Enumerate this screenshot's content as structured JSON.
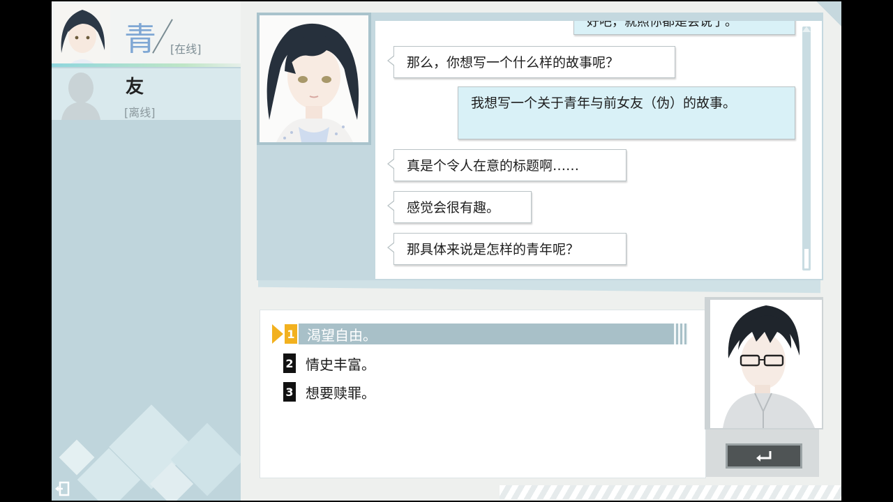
{
  "contacts": {
    "active": {
      "name": "青",
      "status": "[在线]"
    },
    "offline": {
      "name": "友",
      "status": "[离线]"
    }
  },
  "chat": {
    "messages": [
      {
        "side": "right",
        "text": "好吧，就照你都是会说了。"
      },
      {
        "side": "left",
        "text": "那么，你想写一个什么样的故事呢？"
      },
      {
        "side": "right",
        "text": "我想写一个关于青年与前女友（伪）的故事。"
      },
      {
        "side": "left",
        "text": "真是个令人在意的标题啊……"
      },
      {
        "side": "left",
        "text": "感觉会很有趣。"
      },
      {
        "side": "left",
        "text": "那具体来说是怎样的青年呢？"
      }
    ]
  },
  "choices": [
    {
      "number": "1",
      "text": "渴望自由。",
      "selected": true
    },
    {
      "number": "2",
      "text": "情史丰富。",
      "selected": false
    },
    {
      "number": "3",
      "text": "想要赎罪。",
      "selected": false
    }
  ],
  "icons": {
    "return": "return-arrow-icon",
    "exit": "exit-door-icon"
  },
  "colors": {
    "accent_selected": "#f2b11f",
    "panel_blue": "#bfd5dc",
    "online_name": "#7fa7d4"
  }
}
